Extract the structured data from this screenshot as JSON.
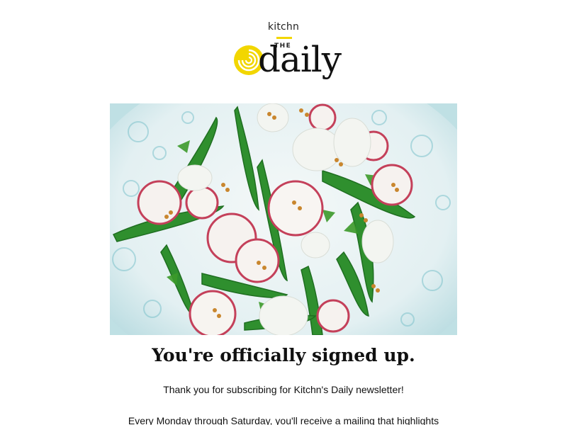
{
  "logo": {
    "brand": "kitchn",
    "the": "THE",
    "daily": "daily",
    "accent_color": "#f2d600"
  },
  "hero_image": {
    "icon": "salad-photo"
  },
  "content": {
    "headline": "You're officially signed up.",
    "thanks": "Thank you for subscribing for Kitchn's Daily newsletter!",
    "body": "Every Monday through Saturday, you'll receive a mailing that highlights"
  }
}
